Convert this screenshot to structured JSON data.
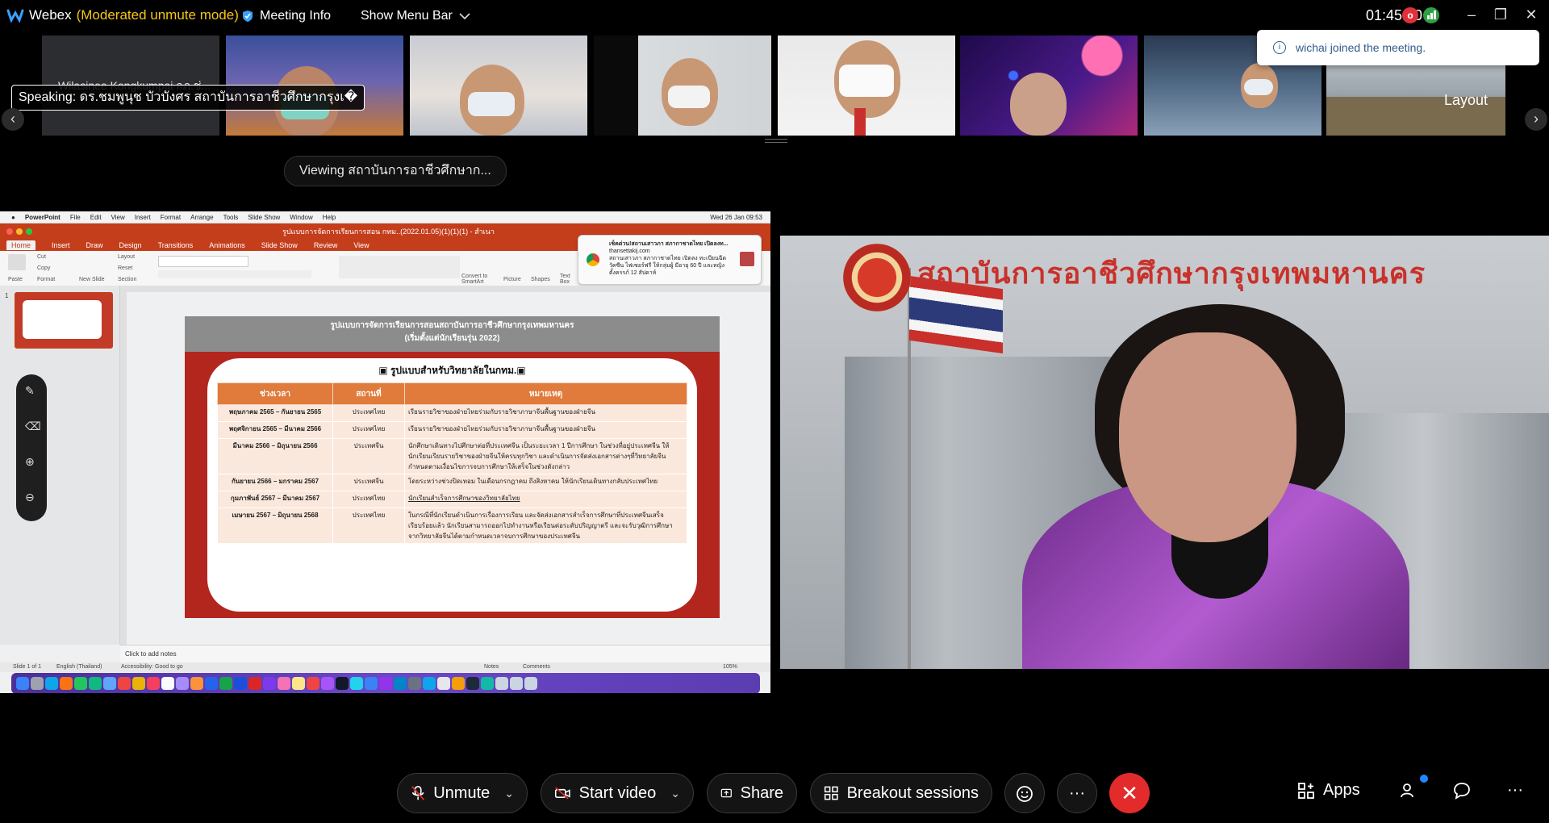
{
  "titlebar": {
    "app_name": "Webex",
    "mode": "(Moderated unmute mode)",
    "meeting_info": "Meeting Info",
    "show_menu_bar": "Show Menu Bar",
    "clock": "01:45:20",
    "rec_badge": "o"
  },
  "filmstrip": {
    "speaking": "Speaking: ดร.ชมพูนุช บัวบังศร สถาบันการอาชีวศึกษากรุงเ�",
    "first_name": "Wilasinee Kongkumpai กภ.ช่...",
    "prev": "‹",
    "next": "›",
    "layout_label": "Layout"
  },
  "toast": {
    "text": "wichai joined the meeting."
  },
  "viewing": "Viewing สถาบันการอาชีวศึกษาก...",
  "ppt": {
    "menubar": [
      "PowerPoint",
      "File",
      "Edit",
      "View",
      "Insert",
      "Format",
      "Arrange",
      "Tools",
      "Slide Show",
      "Window",
      "Help"
    ],
    "menubar_date": "Wed 26 Jan 09:53",
    "doc_title": "รูปแบบการจัดการเรียนการสอน กทม..(2022.01.05)(1)(1)(1) - สำเนา",
    "tabs": [
      "Home",
      "Insert",
      "Draw",
      "Design",
      "Transitions",
      "Animations",
      "Slide Show",
      "Review",
      "View"
    ],
    "ribbon": {
      "paste": "Paste",
      "cut": "Cut",
      "copy": "Copy",
      "format": "Format",
      "new_slide": "New Slide",
      "layout": "Layout",
      "reset": "Reset",
      "section": "Section",
      "convert": "Convert to SmartArt",
      "picture": "Picture",
      "shapes": "Shapes",
      "textbox": "Text Box"
    },
    "popup": {
      "line1": "เช็คด่วน!สถานเสาวภา สภากาชาดไทย เปิดลงท...",
      "line2": "thansettakij.com",
      "line3": "สถานเสาวภา สภากาชาดไทย เปิดลง ทะเบียนฉีดวัคซีน ไฟเซอร์ฟรี ให้กลุ่มผู้ มีอายุ 60 ปี และหญิงตั้งครรภ์ 12 สัปดาห์"
    },
    "slide_num": "1",
    "slide": {
      "head1": "รูปแบบการจัดการเรียนการสอนสถาบันการอาชีวศึกษากรุงเทพมหานคร",
      "head2": "(เริ่มตั้งแต่นักเรียนรุ่น 2022)",
      "card_title": "▣ รูปแบบสำหรับวิทยาลัยในกทม.▣",
      "columns": [
        "ช่วงเวลา",
        "สถานที่",
        "หมายเหตุ"
      ],
      "rows": [
        {
          "period": "พฤษภาคม 2565 – กันยายน 2565",
          "place": "ประเทศไทย",
          "note": "เรียนรายวิชาของฝ่ายไทยร่วมกับรายวิชาภาษาจีนพื้นฐานของฝ่ายจีน"
        },
        {
          "period": "พฤศจิกายน 2565 – มีนาคม 2566",
          "place": "ประเทศไทย",
          "note": "เรียนรายวิชาของฝ่ายไทยร่วมกับรายวิชาภาษาจีนพื้นฐานของฝ่ายจีน"
        },
        {
          "period": "มีนาคม 2566 – มิถุนายน 2566",
          "place": "ประเทศจีน",
          "note": "นักศึกษาเดินทางไปศึกษาต่อที่ประเทศจีน เป็นระยะเวลา 1 ปีการศึกษา ในช่วงที่อยู่ประเทศจีน ให้นักเรียนเรียนรายวิชาของฝ่ายจีนให้ครบทุกวิชา และดำเนินการจัดส่งเอกสารต่างๆที่วิทยาลัยจีนกำหนดตามเงื่อนไขการจบการศึกษาให้เสร็จในช่วงดังกล่าว"
        },
        {
          "period": "กันยายน 2566 – มกราคม 2567",
          "place": "ประเทศจีน",
          "note": "โดยระหว่างช่วงปิดเทอม ในเดือนกรกฎาคม ถึงสิงหาคม ให้นักเรียนเดินทางกลับประเทศไทย"
        },
        {
          "period": "กุมภาพันธ์ 2567 – มีนาคม 2567",
          "place": "ประเทศไทย",
          "note": "นักเรียนสำเร็จการศึกษาของวิทยาลัยไทย"
        },
        {
          "period": "เมษายน 2567 – มิถุนายน 2568",
          "place": "ประเทศไทย",
          "note": "ในกรณีที่นักเรียนดำเนินการเรื่องการเรียน และจัดส่งเอกสารสำเร็จการศึกษาที่ประเทศจีนเสร็จเรียบร้อยแล้ว นักเรียนสามารถออกไปทำงานหรือเรียนต่อระดับปริญญาตรี และจะรับวุฒิการศึกษาจากวิทยาลัยจีนได้ตามกำหนดเวลาจบการศึกษาของประเทศจีน"
        }
      ]
    },
    "notes": "Click to add notes",
    "status": {
      "slide": "Slide 1 of 1",
      "lang": "English (Thailand)",
      "access": "Accessibility: Good to go",
      "notes_btn": "Notes",
      "comments_btn": "Comments",
      "zoom": "105%"
    }
  },
  "speaker_video": {
    "banner": "สถาบันการอาชีวศึกษากรุงเทพมหานคร"
  },
  "controls": {
    "unmute": "Unmute",
    "start_video": "Start video",
    "share": "Share",
    "breakout": "Breakout sessions",
    "more": "···",
    "leave": "✕",
    "apps": "Apps"
  },
  "colors": {
    "mode_text": "#f5c518",
    "leave_red": "#e32b2b",
    "ppt_accent": "#c43e1c",
    "toast_text": "#2f5c8a"
  }
}
